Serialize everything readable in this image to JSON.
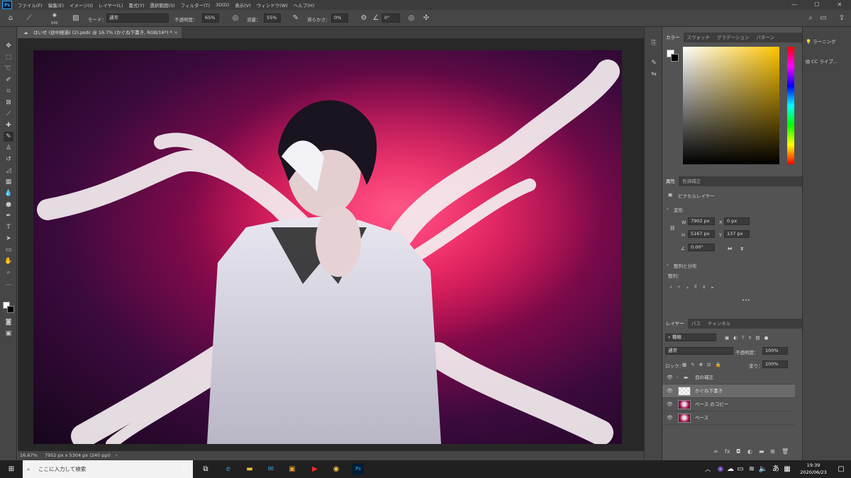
{
  "app": {
    "logo": "Ps",
    "menu": [
      "ファイル(F)",
      "編集(E)",
      "イメージ(I)",
      "レイヤー(L)",
      "書式(Y)",
      "選択範囲(S)",
      "フィルター(T)",
      "3D(D)",
      "表示(V)",
      "ウィンドウ(W)",
      "ヘルプ(H)"
    ],
    "window_controls": [
      "—",
      "☐",
      "✕"
    ]
  },
  "options": {
    "brush_size": "846",
    "mode_label": "モード：",
    "mode_value": "通常",
    "opacity_label": "不透明度：",
    "opacity_value": "65%",
    "flow_label": "流量：",
    "flow_value": "55%",
    "smoothing_label": "滑らかさ：",
    "smoothing_value": "0%",
    "angle_value": "0°"
  },
  "document": {
    "tab_title": "はいせ (途中経過) (2).psdc @ 16.7% (かぐね下書き, RGB/16*) *",
    "zoom": "16.67%",
    "dimensions": "7952 px x 5304 px (240 ppi)"
  },
  "color_panel": {
    "tabs": [
      "カラー",
      "スウォッチ",
      "グラデーション",
      "パターン"
    ]
  },
  "properties_panel": {
    "tabs": [
      "属性",
      "色調補正"
    ],
    "type_label": "ピクセルレイヤー",
    "transform_label": "変形",
    "w_label": "W",
    "w_value": "7902 px",
    "x_label": "X",
    "x_value": "0 px",
    "h_label": "H",
    "h_value": "5167 px",
    "y_label": "Y",
    "y_value": "137 px",
    "angle_value": "0.00°",
    "align_label": "整列と分布",
    "align_sub": "整列：",
    "more": "•••"
  },
  "layers_panel": {
    "tabs": [
      "レイヤー",
      "パス",
      "チャンネル"
    ],
    "filter_value": "種類",
    "blend_value": "通常",
    "opacity_label": "不透明度：",
    "opacity_value": "100%",
    "lock_label": "ロック：",
    "fill_label": "塗り：",
    "fill_value": "100%",
    "layers": [
      {
        "name": "目の補正",
        "kind": "folder"
      },
      {
        "name": "かぐね下書き",
        "kind": "pixel",
        "selected": true
      },
      {
        "name": "ベース のコピー",
        "kind": "photo"
      },
      {
        "name": "ベース",
        "kind": "photo"
      }
    ],
    "footer_icons": [
      "link-icon",
      "fx-icon",
      "mask-icon",
      "adjustment-icon",
      "folder-icon",
      "new-layer-icon",
      "trash-icon"
    ]
  },
  "far_right": {
    "learn": "ラーニング",
    "cc_libraries": "CC ライブ..."
  },
  "taskbar": {
    "search_placeholder": "ここに入力して検索",
    "ime": "あ",
    "time": "19:39",
    "date": "2020/06/23"
  },
  "colors": {
    "ps_blue": "#31a8ff",
    "panel_bg": "#535353",
    "accent_magenta": "#ff2a6e"
  }
}
